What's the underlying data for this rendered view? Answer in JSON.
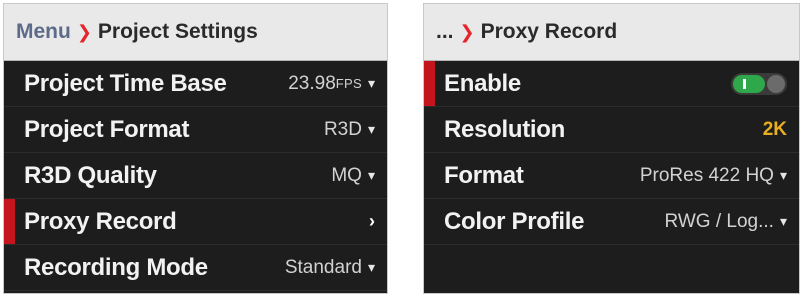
{
  "left_panel": {
    "breadcrumb_root": "Menu",
    "breadcrumb_sep": "❯",
    "title": "Project Settings",
    "rows": [
      {
        "label": "Project Time Base",
        "value": "23.98",
        "unit": "FPS",
        "control": "dropdown"
      },
      {
        "label": "Project Format",
        "value": "R3D",
        "control": "dropdown"
      },
      {
        "label": "R3D Quality",
        "value": "MQ",
        "control": "dropdown"
      },
      {
        "label": "Proxy Record",
        "value": "",
        "control": "submenu",
        "selected": true
      },
      {
        "label": "Recording Mode",
        "value": "Standard",
        "control": "dropdown"
      }
    ]
  },
  "right_panel": {
    "breadcrumb_root": "...",
    "breadcrumb_sep": "❯",
    "title": "Proxy Record",
    "rows": [
      {
        "label": "Enable",
        "control": "toggle",
        "state": "on",
        "selected": true
      },
      {
        "label": "Resolution",
        "value": "2K",
        "control": "value"
      },
      {
        "label": "Format",
        "value": "ProRes 422 HQ",
        "control": "dropdown"
      },
      {
        "label": "Color Profile",
        "value": "RWG / Log...",
        "control": "dropdown"
      }
    ]
  },
  "icons": {
    "dropdown": "▾",
    "submenu": "›"
  },
  "colors": {
    "accent_red": "#c4151d",
    "toggle_green": "#2ea84a",
    "value_yellow": "#e8b020"
  }
}
